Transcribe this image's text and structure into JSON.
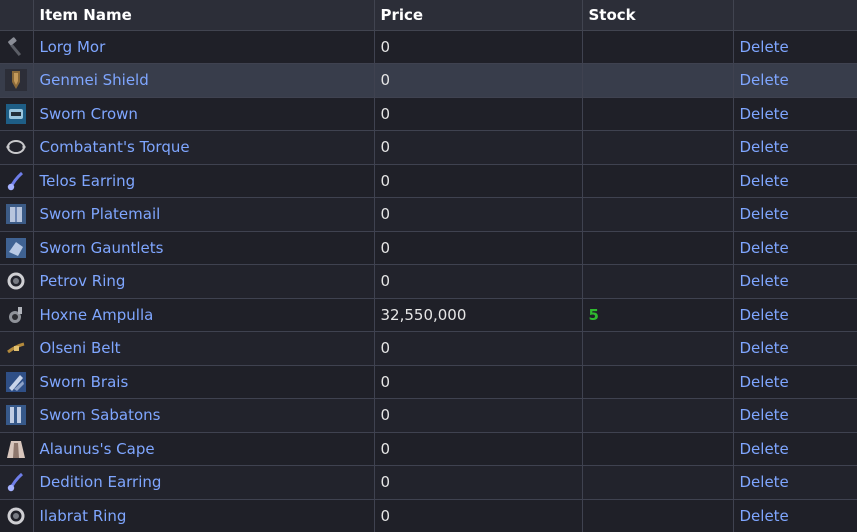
{
  "table": {
    "headers": {
      "icon": "",
      "name": "Item Name",
      "price": "Price",
      "stock": "Stock",
      "actions": ""
    },
    "rows": [
      {
        "icon": "hammer-icon",
        "name": "Lorg Mor",
        "price": "0",
        "stock": "",
        "action": "Delete"
      },
      {
        "icon": "shield-icon",
        "name": "Genmei Shield",
        "price": "0",
        "stock": "",
        "action": "Delete"
      },
      {
        "icon": "crown-icon",
        "name": "Sworn Crown",
        "price": "0",
        "stock": "",
        "action": "Delete"
      },
      {
        "icon": "torque-icon",
        "name": "Combatant's Torque",
        "price": "0",
        "stock": "",
        "action": "Delete"
      },
      {
        "icon": "earring-icon",
        "name": "Telos Earring",
        "price": "0",
        "stock": "",
        "action": "Delete"
      },
      {
        "icon": "platemail-icon",
        "name": "Sworn Platemail",
        "price": "0",
        "stock": "",
        "action": "Delete"
      },
      {
        "icon": "gauntlets-icon",
        "name": "Sworn Gauntlets",
        "price": "0",
        "stock": "",
        "action": "Delete"
      },
      {
        "icon": "ring-icon",
        "name": "Petrov Ring",
        "price": "0",
        "stock": "",
        "action": "Delete"
      },
      {
        "icon": "ampulla-icon",
        "name": "Hoxne Ampulla",
        "price": "32,550,000",
        "stock": "5",
        "action": "Delete"
      },
      {
        "icon": "belt-icon",
        "name": "Olseni Belt",
        "price": "0",
        "stock": "",
        "action": "Delete"
      },
      {
        "icon": "brais-icon",
        "name": "Sworn Brais",
        "price": "0",
        "stock": "",
        "action": "Delete"
      },
      {
        "icon": "sabatons-icon",
        "name": "Sworn Sabatons",
        "price": "0",
        "stock": "",
        "action": "Delete"
      },
      {
        "icon": "cape-icon",
        "name": "Alaunus's Cape",
        "price": "0",
        "stock": "",
        "action": "Delete"
      },
      {
        "icon": "earring-icon",
        "name": "Dedition Earring",
        "price": "0",
        "stock": "",
        "action": "Delete"
      },
      {
        "icon": "ring-icon",
        "name": "Ilabrat Ring",
        "price": "0",
        "stock": "",
        "action": "Delete"
      }
    ]
  },
  "colors": {
    "link": "#7fa6ff",
    "stock": "#2fba2f",
    "selected_row": "#383d4b"
  }
}
